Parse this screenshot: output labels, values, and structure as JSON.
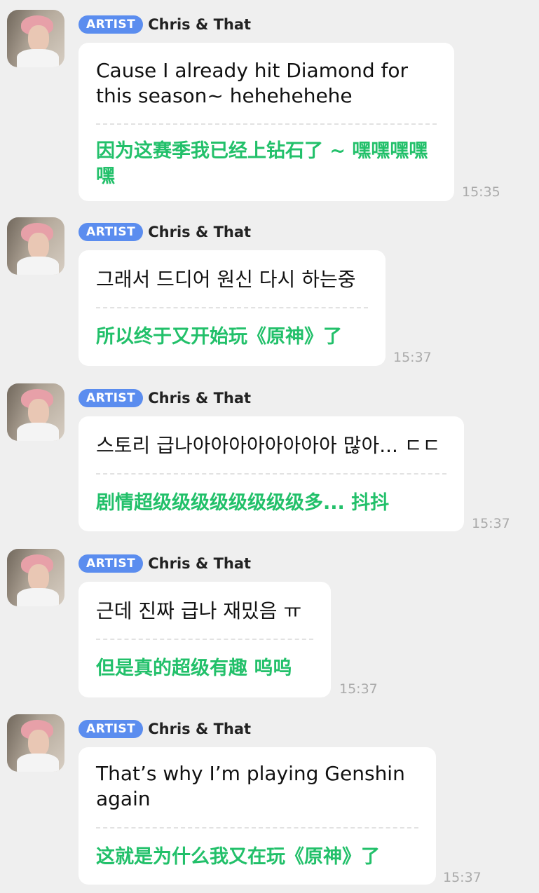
{
  "chat": {
    "messages": [
      {
        "badge": "ARTIST",
        "sender": "Chris & That",
        "original": "Cause I already hit Diamond for this season~ hehehehehe",
        "translation": "因为这赛季我已经上钻石了 ~ 嘿嘿嘿嘿嘿",
        "time": "15:35"
      },
      {
        "badge": "ARTIST",
        "sender": "Chris & That",
        "original": "그래서 드디어 원신 다시 하는중",
        "translation": "所以终于又开始玩《原神》了",
        "time": "15:37"
      },
      {
        "badge": "ARTIST",
        "sender": "Chris & That",
        "original": "스토리 급나아아아아아아아아 많아... ㄷㄷ",
        "translation": "剧情超级级级级级级级级多... 抖抖",
        "time": "15:37"
      },
      {
        "badge": "ARTIST",
        "sender": "Chris & That",
        "original": "근데 진짜 급나 재밌음 ㅠ",
        "translation": "但是真的超级有趣 呜呜",
        "time": "15:37"
      },
      {
        "badge": "ARTIST",
        "sender": "Chris & That",
        "original": "That’s why I’m playing Genshin again",
        "translation": "这就是为什么我又在玩《原神》了",
        "time": "15:37"
      }
    ]
  }
}
